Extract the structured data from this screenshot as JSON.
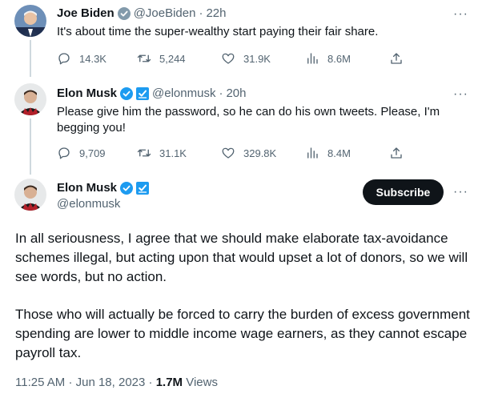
{
  "tweets": [
    {
      "name": "Joe Biden",
      "handle": "@JoeBiden",
      "sep": "·",
      "time": "22h",
      "more": "···",
      "text": "It's about time the super-wealthy start paying their fair share.",
      "stats": {
        "replies": "14.3K",
        "retweets": "5,244",
        "likes": "31.9K",
        "views": "8.6M"
      }
    },
    {
      "name": "Elon Musk",
      "handle": "@elonmusk",
      "sep": "·",
      "time": "20h",
      "more": "···",
      "text": "Please give him the password, so he can do his own tweets. Please, I'm begging you!",
      "stats": {
        "replies": "9,709",
        "retweets": "31.1K",
        "likes": "329.8K",
        "views": "8.4M"
      }
    }
  ],
  "focused": {
    "name": "Elon Musk",
    "handle": "@elonmusk",
    "subscribe_label": "Subscribe",
    "more": "···",
    "paragraph1": "In all seriousness, I agree that we should make elaborate tax-avoidance schemes illegal, but acting upon that would upset a lot of donors, so we will see words, but no action.",
    "paragraph2": "Those who will actually be forced to carry the burden of excess government spending are lower to middle income wage earners, as they cannot escape payroll tax.",
    "time": "11:25 AM",
    "sep1": "·",
    "date": "Jun 18, 2023",
    "sep2": "·",
    "views_count": "1.7M",
    "views_label": "Views"
  },
  "colors": {
    "verified_gold": "#e2b719",
    "verified_blue": "#1d9bf0",
    "text_secondary": "#536471",
    "button_bg": "#0f1419"
  },
  "icons": [
    "reply-icon",
    "retweet-icon",
    "like-icon",
    "views-icon",
    "share-icon",
    "verified-badge-icon",
    "affiliate-badge-icon",
    "more-icon"
  ]
}
